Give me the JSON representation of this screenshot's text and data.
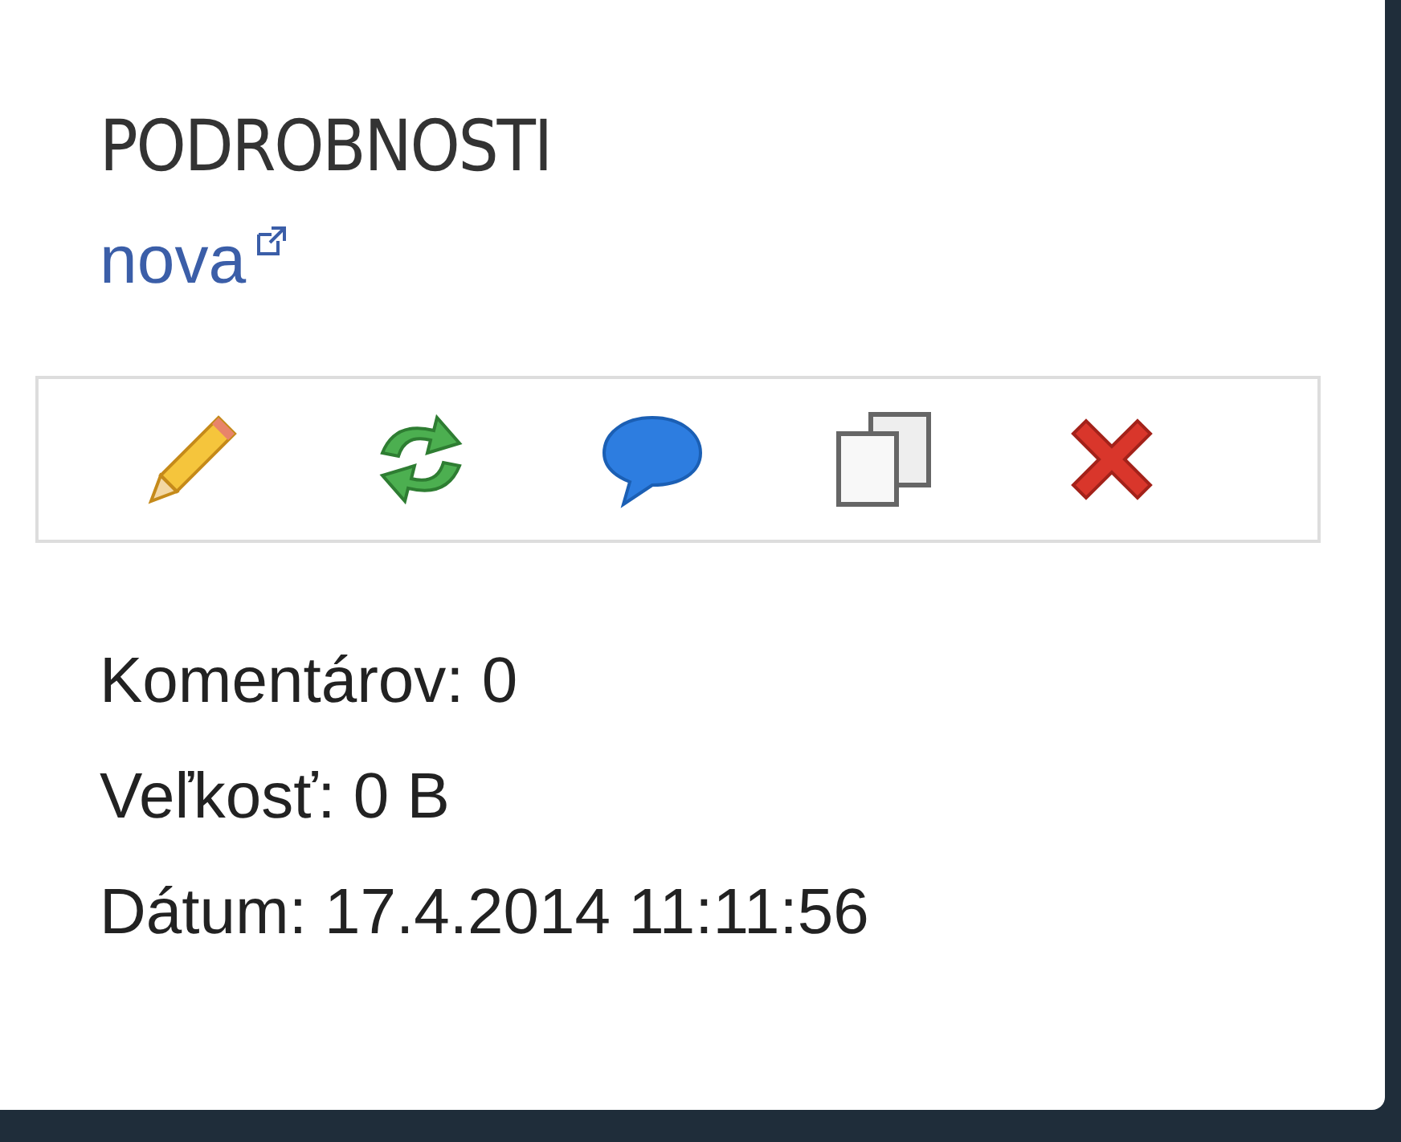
{
  "panel": {
    "title": "PODROBNOSTI",
    "link": "nova",
    "actions": [
      {
        "kind": "edit"
      },
      {
        "kind": "refresh"
      },
      {
        "kind": "comment"
      },
      {
        "kind": "copy"
      },
      {
        "kind": "delete"
      }
    ],
    "info": [
      "Komentárov: 0",
      "Veľkosť: 0 B",
      "Dátum: 17.4.2014 11:11:56"
    ]
  }
}
